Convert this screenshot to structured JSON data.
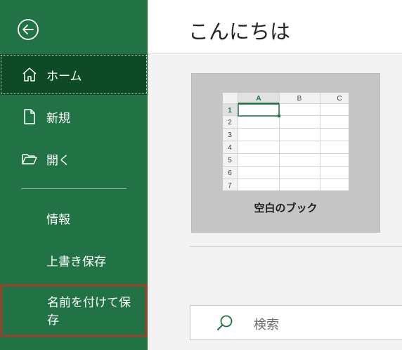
{
  "sidebar": {
    "back_icon": "back-arrow-icon",
    "items": [
      {
        "label": "ホーム",
        "icon": "home-icon"
      },
      {
        "label": "新規",
        "icon": "new-document-icon"
      },
      {
        "label": "開く",
        "icon": "folder-open-icon"
      }
    ],
    "sub_items": [
      {
        "label": "情報"
      },
      {
        "label": "上書き保存"
      },
      {
        "label": "名前を付けて保存"
      }
    ],
    "colors": {
      "bg": "#217346",
      "selected": "#0e4a25",
      "highlight_border": "#e0201b"
    }
  },
  "main": {
    "greeting": "こんにちは",
    "template": {
      "label": "空白のブック",
      "columns": [
        "A",
        "B",
        "C"
      ],
      "rows": [
        "1",
        "2",
        "3",
        "4",
        "5",
        "6",
        "7"
      ]
    },
    "search": {
      "placeholder": "検索"
    }
  }
}
